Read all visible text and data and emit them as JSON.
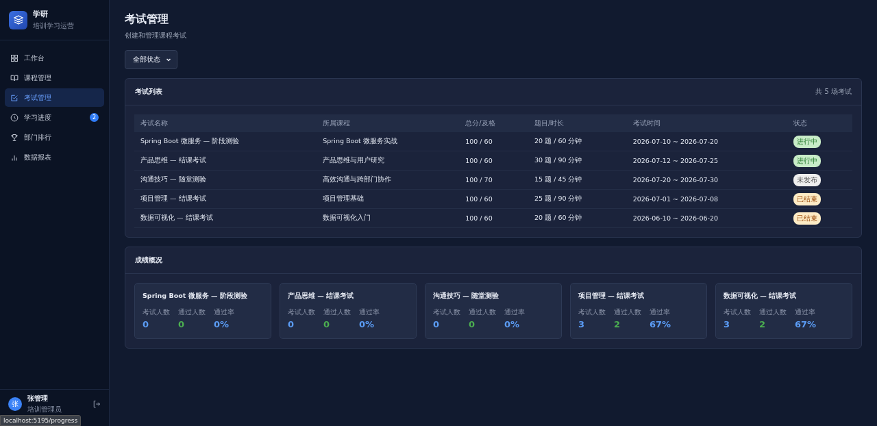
{
  "brand": {
    "name": "学研",
    "subtitle": "培训学习运营"
  },
  "nav": [
    {
      "label": "工作台",
      "selected": false
    },
    {
      "label": "课程管理",
      "selected": false
    },
    {
      "label": "考试管理",
      "selected": true
    },
    {
      "label": "学习进度",
      "selected": false,
      "badge": "2"
    },
    {
      "label": "部门排行",
      "selected": false
    },
    {
      "label": "数据报表",
      "selected": false
    }
  ],
  "user": {
    "avatar": "张",
    "name": "张管理",
    "role": "培训管理员"
  },
  "browser_status": "localhost:5195/progress",
  "page": {
    "title": "考试管理",
    "subtitle": "创建和管理课程考试"
  },
  "filter": {
    "value": "全部状态"
  },
  "exam_list": {
    "title": "考试列表",
    "count": "共 5 场考试",
    "columns": [
      "考试名称",
      "所属课程",
      "总分/及格",
      "题目/时长",
      "考试时间",
      "状态"
    ],
    "rows": [
      {
        "cells": [
          "Spring Boot 微服务 — 阶段测验",
          "Spring Boot 微服务实战",
          "100 / 60",
          "20 题 / 60 分钟",
          "2026-07-10 ~ 2026-07-20"
        ],
        "status": {
          "label": "进行中",
          "kind": "active"
        }
      },
      {
        "cells": [
          "产品思维 — 结课考试",
          "产品思维与用户研究",
          "100 / 60",
          "30 题 / 90 分钟",
          "2026-07-12 ~ 2026-07-25"
        ],
        "status": {
          "label": "进行中",
          "kind": "active"
        }
      },
      {
        "cells": [
          "沟通技巧 — 随堂测验",
          "高效沟通与跨部门协作",
          "100 / 70",
          "15 题 / 45 分钟",
          "2026-07-20 ~ 2026-07-30"
        ],
        "status": {
          "label": "未发布",
          "kind": "draft"
        }
      },
      {
        "cells": [
          "项目管理 — 结课考试",
          "项目管理基础",
          "100 / 60",
          "25 题 / 90 分钟",
          "2026-07-01 ~ 2026-07-08"
        ],
        "status": {
          "label": "已结束",
          "kind": "ended"
        }
      },
      {
        "cells": [
          "数据可视化 — 结课考试",
          "数据可视化入门",
          "100 / 60",
          "20 题 / 60 分钟",
          "2026-06-10 ~ 2026-06-20"
        ],
        "status": {
          "label": "已结束",
          "kind": "ended"
        }
      }
    ]
  },
  "scores": {
    "title": "成绩概况",
    "cards": [
      {
        "title": "Spring Boot 微服务 — 阶段测验",
        "stats": [
          {
            "label": "考试人数",
            "value": "0",
            "color": "#5b9cf5"
          },
          {
            "label": "通过人数",
            "value": "0",
            "color": "#4caf50"
          },
          {
            "label": "通过率",
            "value": "0%",
            "color": "#5b9cf5"
          }
        ]
      },
      {
        "title": "产品思维 — 结课考试",
        "stats": [
          {
            "label": "考试人数",
            "value": "0",
            "color": "#5b9cf5"
          },
          {
            "label": "通过人数",
            "value": "0",
            "color": "#4caf50"
          },
          {
            "label": "通过率",
            "value": "0%",
            "color": "#5b9cf5"
          }
        ]
      },
      {
        "title": "沟通技巧 — 随堂测验",
        "stats": [
          {
            "label": "考试人数",
            "value": "0",
            "color": "#5b9cf5"
          },
          {
            "label": "通过人数",
            "value": "0",
            "color": "#4caf50"
          },
          {
            "label": "通过率",
            "value": "0%",
            "color": "#5b9cf5"
          }
        ]
      },
      {
        "title": "项目管理 — 结课考试",
        "stats": [
          {
            "label": "考试人数",
            "value": "3",
            "color": "#5b9cf5"
          },
          {
            "label": "通过人数",
            "value": "2",
            "color": "#4caf50"
          },
          {
            "label": "通过率",
            "value": "67%",
            "color": "#5b9cf5"
          }
        ]
      },
      {
        "title": "数据可视化 — 结课考试",
        "stats": [
          {
            "label": "考试人数",
            "value": "3",
            "color": "#5b9cf5"
          },
          {
            "label": "通过人数",
            "value": "2",
            "color": "#4caf50"
          },
          {
            "label": "通过率",
            "value": "67%",
            "color": "#5b9cf5"
          }
        ]
      }
    ]
  }
}
